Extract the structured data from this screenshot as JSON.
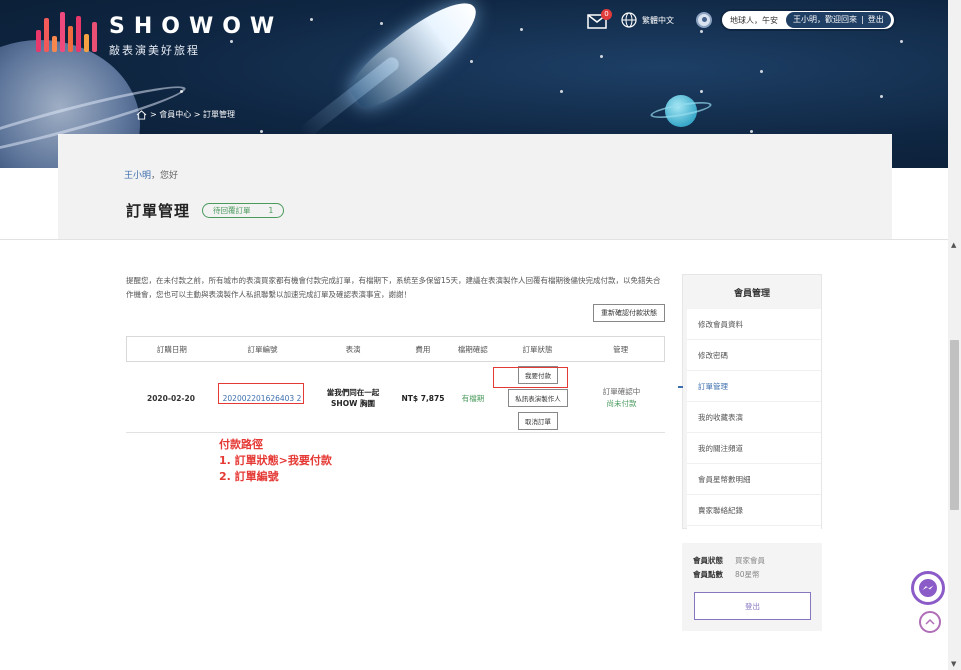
{
  "brand": {
    "name": "SHOWOW",
    "slogan": "敲表演美好旅程",
    "bar_colors": [
      "#e8376b",
      "#f25a5a",
      "#f7874c",
      "#ef4a7e",
      "#f06b3f",
      "#e8376b",
      "#f5a042",
      "#ea4f74"
    ]
  },
  "topbar": {
    "mail_count": "0",
    "language": "繁體中文",
    "greeting": "地球人，午安",
    "welcome": "王小明，歡迎回來",
    "separator": "|",
    "logout": "登出"
  },
  "breadcrumb": {
    "home_icon": "home-icon",
    "path": "> 會員中心 > 訂單管理"
  },
  "header": {
    "user_name": "王小明",
    "hello_suffix": "，您好",
    "title": "訂單管理",
    "pending_label": "待回覆訂單",
    "pending_count": "1"
  },
  "notice": {
    "text": "提醒您，在未付款之前，所有城市的表演買家都有機會付款完成訂單，有檔期下，系統至多保留15天，建議在表演製作人回覆有檔期後儘快完成付款，以免錯失合作機會，您也可以主動與表演製作人私訊聯繫以加速完成訂單及確認表演事宜，謝謝！",
    "refresh_button": "重新確認付款狀態"
  },
  "table": {
    "columns": [
      "訂購日期",
      "訂單編號",
      "表演",
      "費用",
      "檔期確認",
      "訂單狀態",
      "管理"
    ],
    "row": {
      "date": "2020-02-20",
      "order_no": "202002201626403 2",
      "show_line1": "當我們同在一起",
      "show_line2": "SHOW 胸圍",
      "fee": "NT$ 7,875",
      "confirm": "有檔期",
      "status_buttons": {
        "pay": "我要付款",
        "message": "私訊表演製作人",
        "cancel": "取消訂單"
      },
      "manage_line1": "訂單確認中",
      "manage_line2": "尚未付款"
    }
  },
  "annotation": {
    "title": "付款路徑",
    "line1": "1. 訂單狀態>我要付款",
    "line2": "2. 訂單編號"
  },
  "sidebar": {
    "title": "會員管理",
    "items": [
      {
        "label": "修改會員資料",
        "active": false
      },
      {
        "label": "修改密碼",
        "active": false
      },
      {
        "label": "訂單管理",
        "active": true
      },
      {
        "label": "我的收藏表演",
        "active": false
      },
      {
        "label": "我的關注頻道",
        "active": false
      },
      {
        "label": "會員星幣數明細",
        "active": false
      },
      {
        "label": "賣家聯絡紀錄",
        "active": false
      }
    ]
  },
  "member": {
    "status_label": "會員狀態",
    "status_value": "買家會員",
    "points_label": "會員點數",
    "points_value": "80星幣",
    "logout_button": "登出"
  },
  "colors": {
    "accent_blue": "#3d6fae",
    "green": "#4a9a5c",
    "annotation_red": "#e53935",
    "banner_dark": "#0f2642"
  }
}
